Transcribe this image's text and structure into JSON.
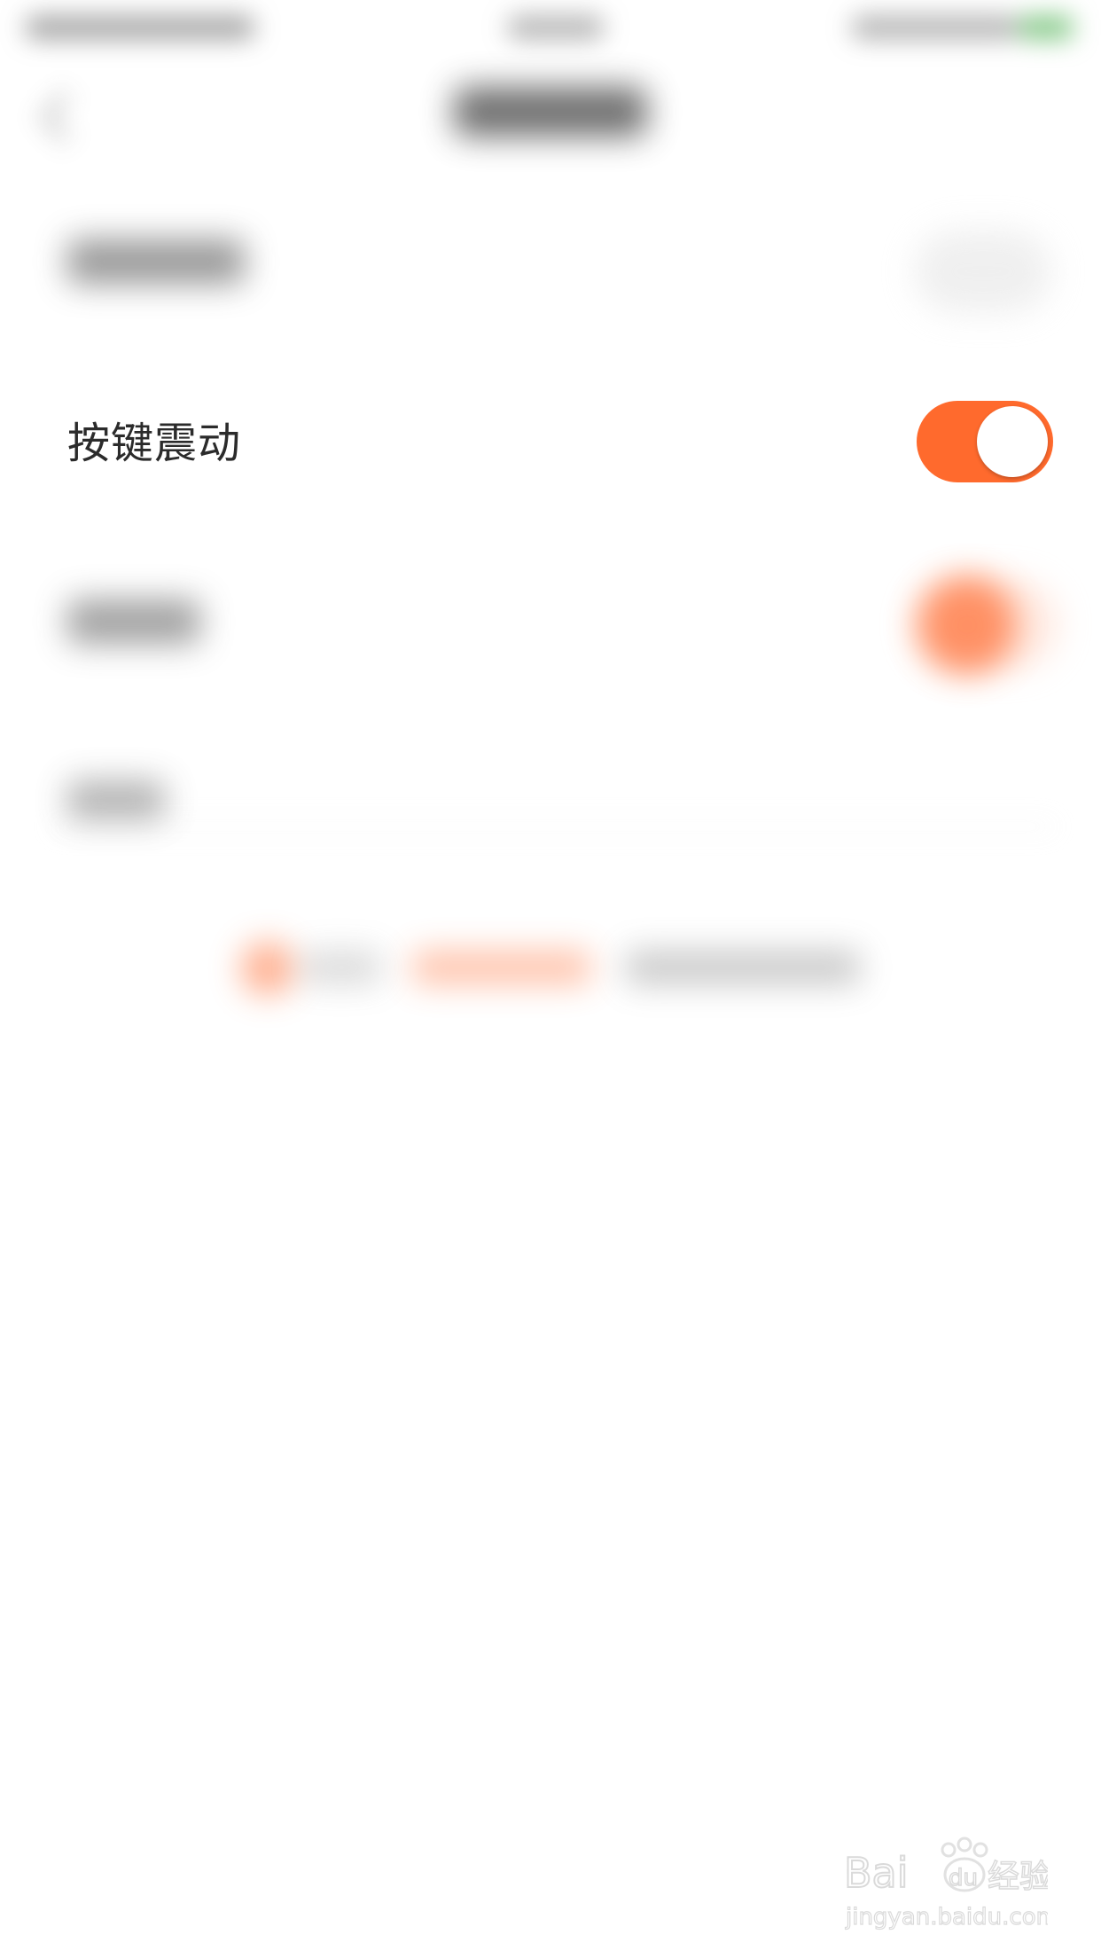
{
  "settings": {
    "rows": [
      {
        "label": "按键震动",
        "toggle_on": true
      }
    ]
  },
  "colors": {
    "accent": "#ff6a2d",
    "background": "#ffffff",
    "text": "#2b2b2b"
  },
  "watermark": {
    "brand": "Baidu经验",
    "url": "jingyan.baidu.com"
  }
}
